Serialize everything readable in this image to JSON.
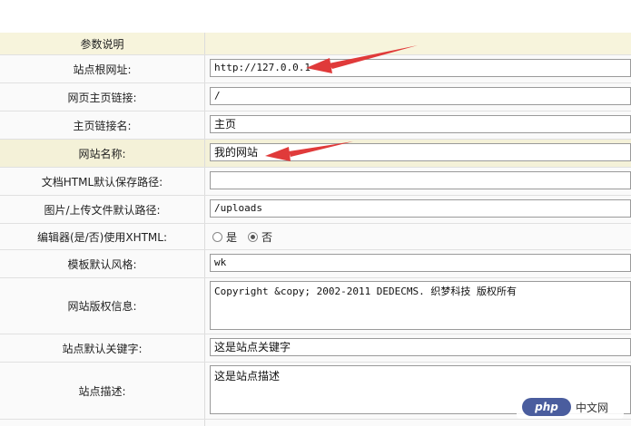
{
  "header_label": "参数说明",
  "fields": {
    "site_url": {
      "label": "站点根网址:",
      "value": "http://127.0.0.1"
    },
    "home_link": {
      "label": "网页主页链接:",
      "value": "/"
    },
    "home_link_name": {
      "label": "主页链接名:",
      "value": "主页"
    },
    "site_name": {
      "label": "网站名称:",
      "value": "我的网站"
    },
    "html_path": {
      "label": "文档HTML默认保存路径:",
      "value": ""
    },
    "upload_path": {
      "label": "图片/上传文件默认路径:",
      "value": "/uploads"
    },
    "editor_xhtml": {
      "label": "编辑器(是/否)使用XHTML:",
      "option_yes": "是",
      "option_no": "否",
      "selected": "否"
    },
    "template_style": {
      "label": "模板默认风格:",
      "value": "wk"
    },
    "copyright": {
      "label": "网站版权信息:",
      "value": "Copyright &copy; 2002-2011 DEDECMS. 织梦科技 版权所有"
    },
    "keywords": {
      "label": "站点默认关键字:",
      "value": "这是站点关键字"
    },
    "description": {
      "label": "站点描述:",
      "value": "这是站点描述"
    }
  },
  "annotation_color": "#e03a3a",
  "watermark": {
    "logo_text": "php",
    "text": "中文网"
  }
}
